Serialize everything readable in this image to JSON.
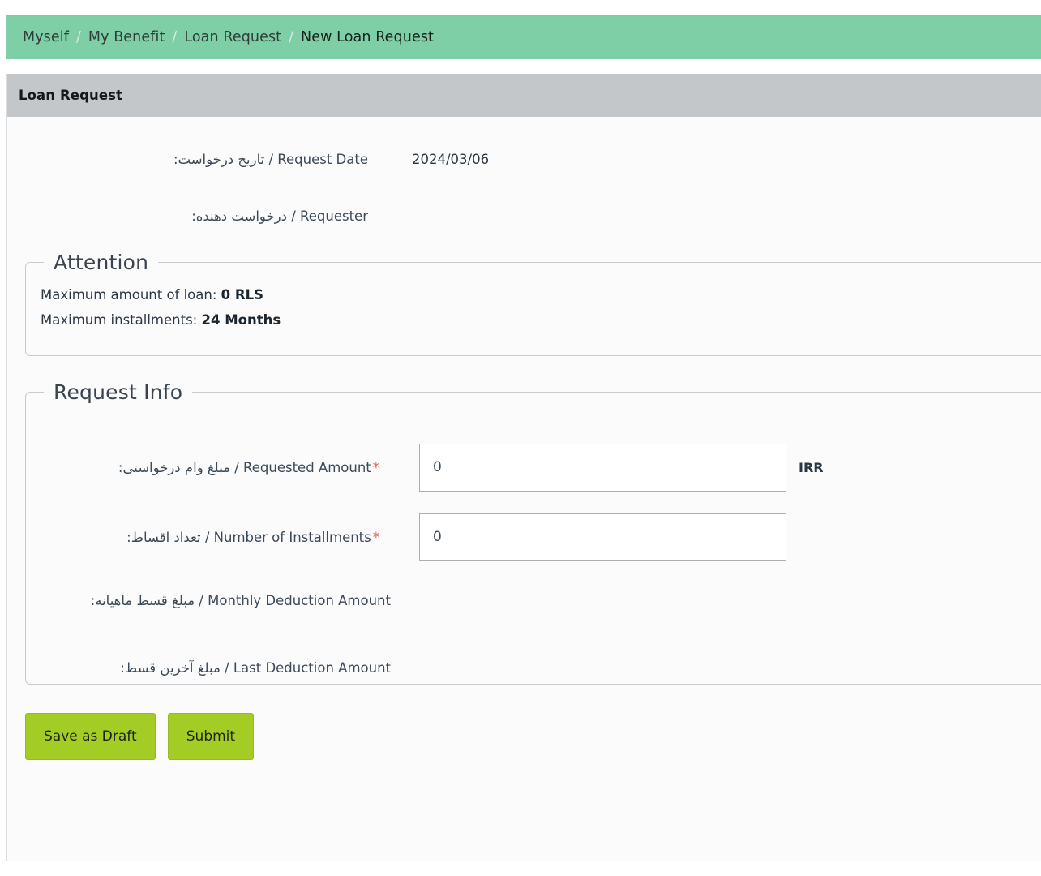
{
  "breadcrumb": {
    "separator": "/",
    "items": [
      {
        "label": "Myself",
        "active": false
      },
      {
        "label": "My Benefit",
        "active": false
      },
      {
        "label": "Loan Request",
        "active": false
      },
      {
        "label": "New Loan Request",
        "active": true
      }
    ]
  },
  "panel": {
    "title": "Loan Request"
  },
  "info": {
    "request_date_label": "Request Date / تاریخ درخواست:",
    "request_date_value": "2024/03/06",
    "requester_label": "Requester / درخواست دهنده:",
    "requester_value": ""
  },
  "attention": {
    "legend": "Attention",
    "max_amount_label": "Maximum amount of loan:",
    "max_amount_value": "0 RLS",
    "max_installments_label": "Maximum installments:",
    "max_installments_value": "24 Months"
  },
  "request_info": {
    "legend": "Request Info",
    "requested_amount_label": "Requested Amount / مبلغ وام درخواستی:",
    "requested_amount_value": "0",
    "requested_amount_unit": "IRR",
    "required_marker": "*",
    "installments_label": "Number of Installments / تعداد اقساط:",
    "installments_value": "0",
    "monthly_deduction_label": "Monthly Deduction Amount / مبلغ قسط ماهیانه:",
    "monthly_deduction_value": "",
    "last_deduction_label": "Last Deduction Amount / مبلغ آخرین قسط:",
    "last_deduction_value": ""
  },
  "actions": {
    "save_draft_label": "Save as Draft",
    "submit_label": "Submit"
  },
  "colors": {
    "breadcrumb_bg": "#7ecfa6",
    "panel_heading_bg": "#c4c7ca",
    "button_bg": "#a3cd25",
    "required_star": "#ec4f4f",
    "page_bg": "#fbfbfc"
  }
}
